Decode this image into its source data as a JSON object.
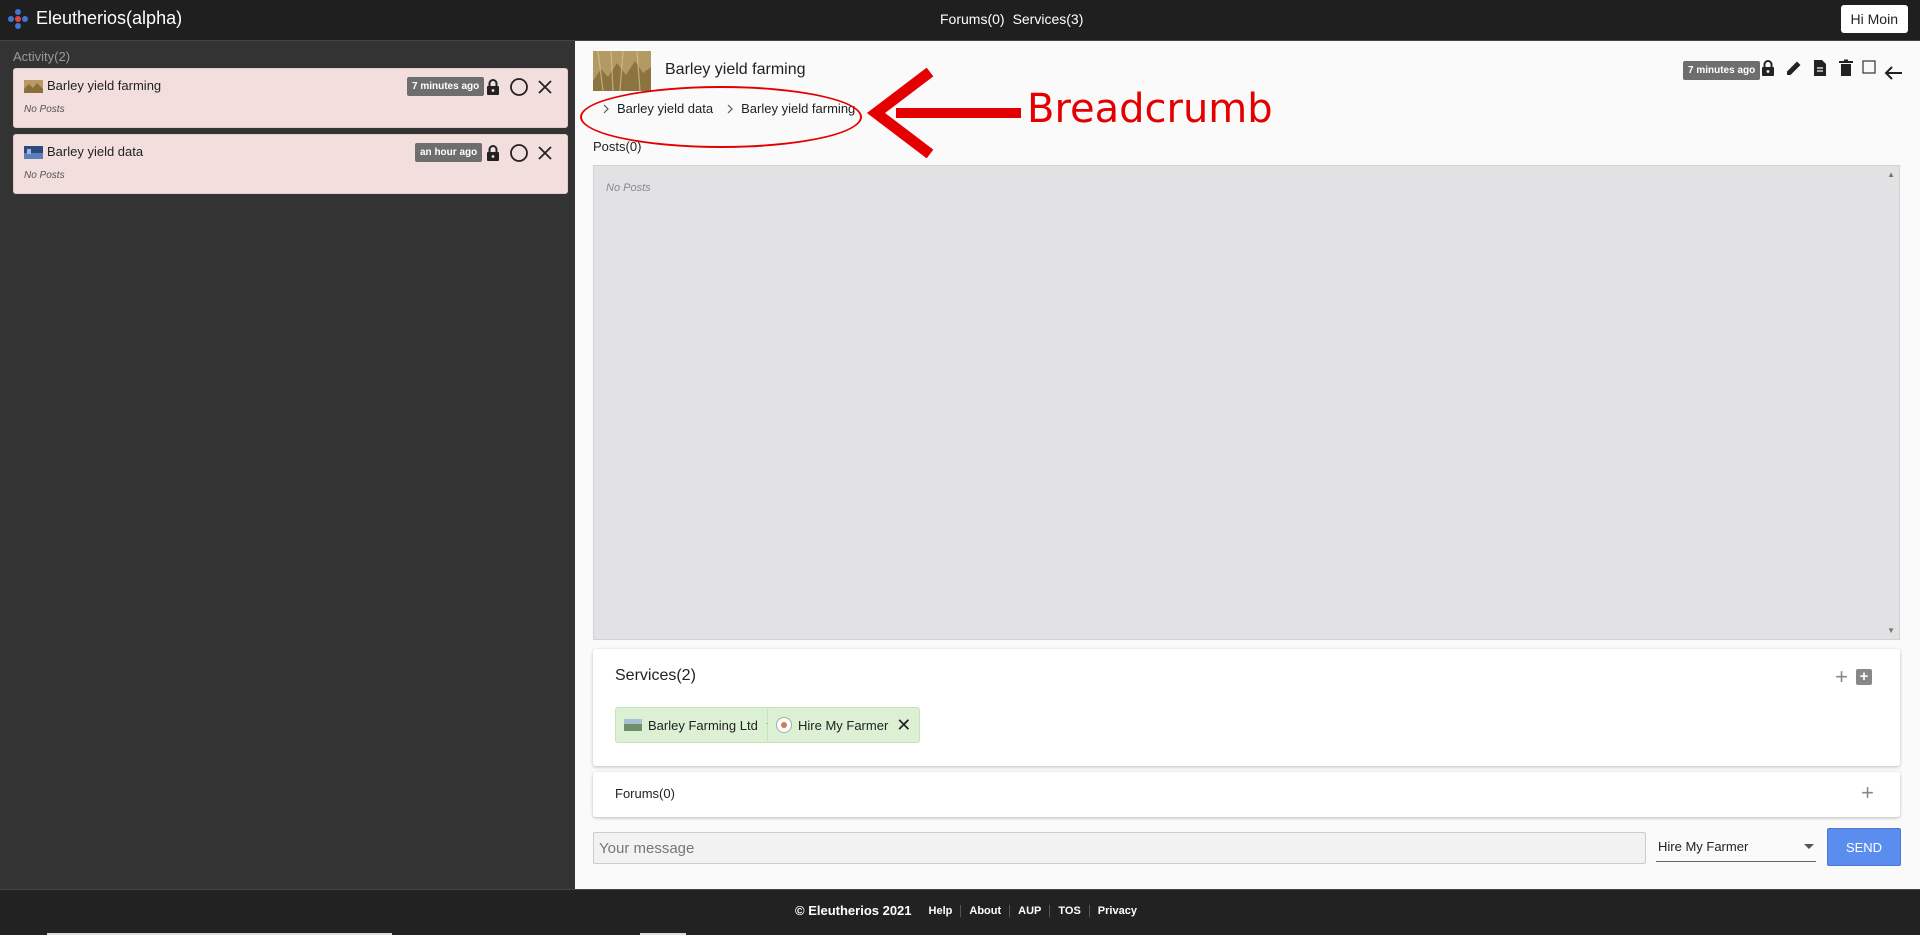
{
  "app": {
    "title": "Eleutherios(alpha)",
    "greeting": "Hi Moin"
  },
  "topnav": {
    "forums": "Forums(0)",
    "services": "Services(3)"
  },
  "sidebar": {
    "heading": "Activity(2)",
    "items": [
      {
        "title": "Barley yield farming",
        "subtitle": "No Posts",
        "time": "7 minutes ago"
      },
      {
        "title": "Barley yield data",
        "subtitle": "No Posts",
        "time": "an hour ago"
      }
    ]
  },
  "forum": {
    "title": "Barley yield farming",
    "time": "7 minutes ago",
    "breadcrumb": [
      "Barley yield data",
      "Barley yield farming"
    ],
    "posts_heading": "Posts(0)",
    "posts_empty": "No Posts"
  },
  "services": {
    "heading": "Services(2)",
    "items": [
      {
        "label": "Barley Farming Ltd"
      },
      {
        "label": "Hire My Farmer"
      }
    ]
  },
  "forums": {
    "heading": "Forums(0)"
  },
  "composer": {
    "placeholder": "Your message",
    "selected": "Hire My Farmer",
    "send_label": "SEND"
  },
  "annotation": {
    "label": "Breadcrumb",
    "color": "#e40000"
  },
  "footer": {
    "copyright": "© Eleutherios 2021",
    "links": [
      "Help",
      "About",
      "AUP",
      "TOS",
      "Privacy"
    ]
  },
  "colors": {
    "accent": "#5b8def",
    "card_bg": "#f3dede",
    "chip_bg": "#dcf0d3",
    "sidebar_bg": "#333333",
    "topbar_bg": "#1f1f1f"
  }
}
